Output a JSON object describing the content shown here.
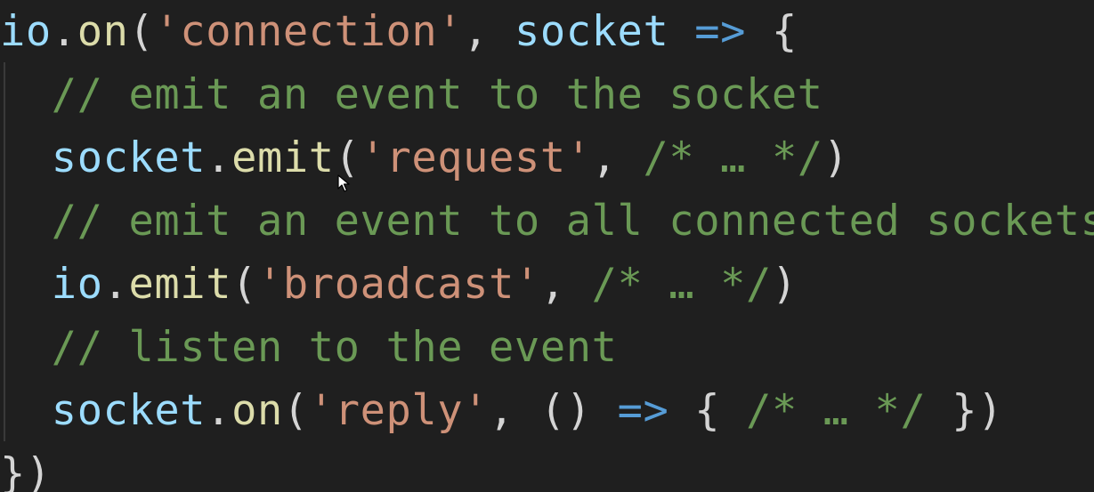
{
  "code": {
    "lines": [
      {
        "tokens": [
          {
            "text": "io",
            "kind": "var"
          },
          {
            "text": ".",
            "kind": "punc"
          },
          {
            "text": "on",
            "kind": "fn"
          },
          {
            "text": "(",
            "kind": "punc"
          },
          {
            "text": "'connection'",
            "kind": "str"
          },
          {
            "text": ", ",
            "kind": "punc"
          },
          {
            "text": "socket",
            "kind": "var"
          },
          {
            "text": " ",
            "kind": "punc"
          },
          {
            "text": "=>",
            "kind": "kw"
          },
          {
            "text": " {",
            "kind": "punc"
          }
        ]
      },
      {
        "tokens": [
          {
            "text": "  ",
            "kind": "punc"
          },
          {
            "text": "// emit an event to the socket",
            "kind": "cmt"
          }
        ]
      },
      {
        "tokens": [
          {
            "text": "  ",
            "kind": "punc"
          },
          {
            "text": "socket",
            "kind": "var"
          },
          {
            "text": ".",
            "kind": "punc"
          },
          {
            "text": "emit",
            "kind": "fn"
          },
          {
            "text": "(",
            "kind": "punc"
          },
          {
            "text": "'request'",
            "kind": "str"
          },
          {
            "text": ", ",
            "kind": "punc"
          },
          {
            "text": "/* … */",
            "kind": "cmt"
          },
          {
            "text": ")",
            "kind": "punc"
          }
        ]
      },
      {
        "tokens": [
          {
            "text": "  ",
            "kind": "punc"
          },
          {
            "text": "// emit an event to all connected sockets",
            "kind": "cmt"
          }
        ]
      },
      {
        "tokens": [
          {
            "text": "  ",
            "kind": "punc"
          },
          {
            "text": "io",
            "kind": "var"
          },
          {
            "text": ".",
            "kind": "punc"
          },
          {
            "text": "emit",
            "kind": "fn"
          },
          {
            "text": "(",
            "kind": "punc"
          },
          {
            "text": "'broadcast'",
            "kind": "str"
          },
          {
            "text": ", ",
            "kind": "punc"
          },
          {
            "text": "/* … */",
            "kind": "cmt"
          },
          {
            "text": ")",
            "kind": "punc"
          }
        ]
      },
      {
        "tokens": [
          {
            "text": "  ",
            "kind": "punc"
          },
          {
            "text": "// listen to the event",
            "kind": "cmt"
          }
        ]
      },
      {
        "tokens": [
          {
            "text": "  ",
            "kind": "punc"
          },
          {
            "text": "socket",
            "kind": "var"
          },
          {
            "text": ".",
            "kind": "punc"
          },
          {
            "text": "on",
            "kind": "fn"
          },
          {
            "text": "(",
            "kind": "punc"
          },
          {
            "text": "'reply'",
            "kind": "str"
          },
          {
            "text": ", ",
            "kind": "punc"
          },
          {
            "text": "()",
            "kind": "punc"
          },
          {
            "text": " ",
            "kind": "punc"
          },
          {
            "text": "=>",
            "kind": "kw"
          },
          {
            "text": " { ",
            "kind": "punc"
          },
          {
            "text": "/* … */",
            "kind": "cmt"
          },
          {
            "text": " })",
            "kind": "punc"
          }
        ]
      },
      {
        "tokens": [
          {
            "text": "})",
            "kind": "punc"
          }
        ]
      }
    ]
  },
  "icons": {
    "cursor": "mouse-pointer-icon"
  },
  "colors": {
    "background": "#1f1f1f",
    "variable": "#9cdcfe",
    "function": "#dcdcaa",
    "string": "#ce9178",
    "punctuation": "#d4d4d4",
    "keyword": "#569cd6",
    "comment": "#6a9955"
  }
}
